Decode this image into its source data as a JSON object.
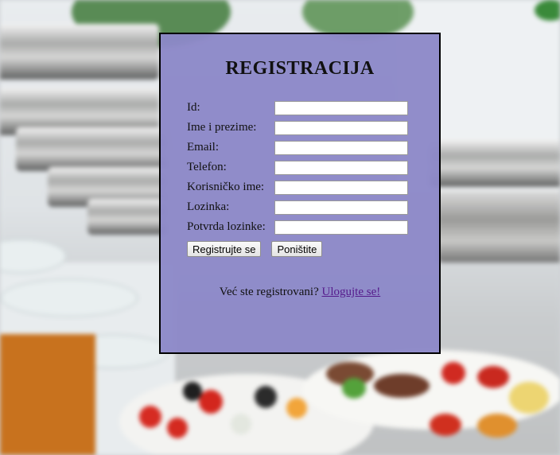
{
  "form": {
    "title": "REGISTRACIJA",
    "fields": [
      {
        "label": "Id:",
        "value": ""
      },
      {
        "label": "Ime i prezime:",
        "value": ""
      },
      {
        "label": "Email:",
        "value": ""
      },
      {
        "label": "Telefon:",
        "value": ""
      },
      {
        "label": "Korisničko ime:",
        "value": ""
      },
      {
        "label": "Lozinka:",
        "value": ""
      },
      {
        "label": "Potvrda lozinke:",
        "value": ""
      }
    ],
    "submit_label": "Registrujte se",
    "reset_label": "Poništite"
  },
  "footer": {
    "prompt": "Već ste registrovani?",
    "login_link": "Ulogujte se!"
  }
}
